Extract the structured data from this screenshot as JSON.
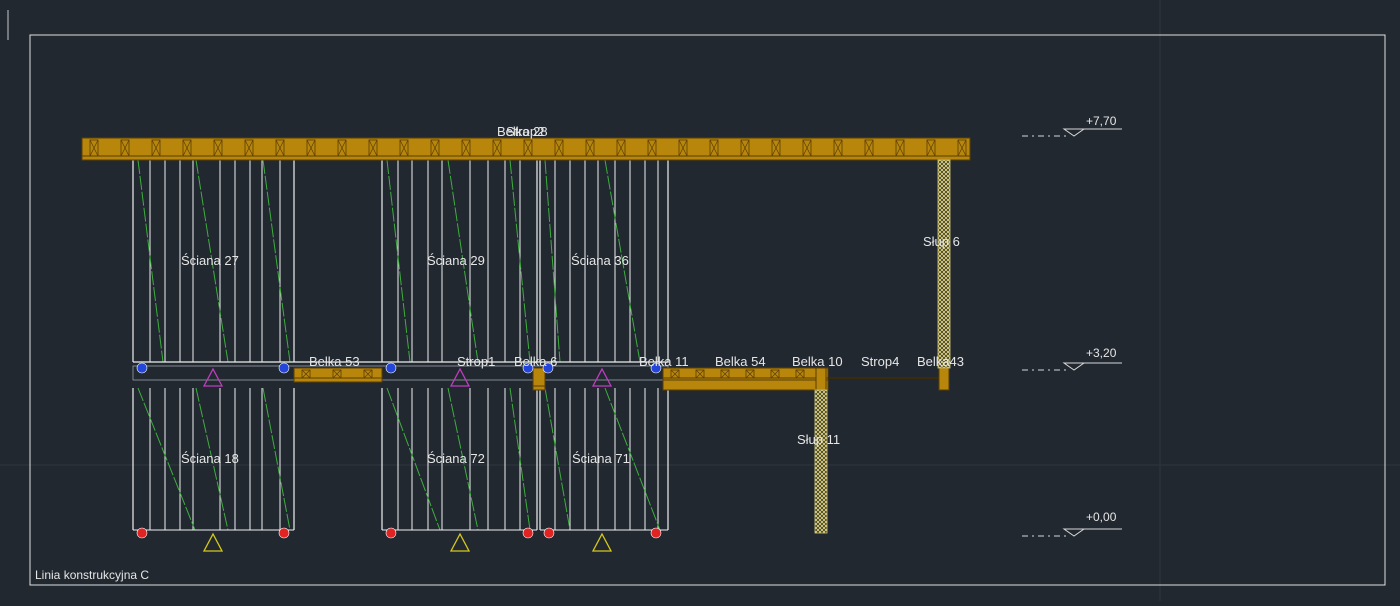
{
  "frame": {
    "caption": "Linia konstrukcyjna C"
  },
  "levels": [
    {
      "label": "+7,70"
    },
    {
      "label": "+3,20"
    },
    {
      "label": "+0,00"
    }
  ],
  "elements": {
    "top_slab": "Strop2",
    "top_beam_overlap": "Belka 28",
    "wall_27": "Ściana 27",
    "wall_29": "Ściana 29",
    "wall_36": "Ściana 36",
    "wall_18": "Ściana 18",
    "wall_72": "Ściana 72",
    "wall_71": "Ściana 71",
    "beam_53": "Belka 53",
    "slab_1": "Strop1",
    "beam_6": "Belka 6",
    "beam_11": "Belka 11",
    "beam_54": "Belka 54",
    "beam_10": "Belka 10",
    "slab_4": "Strop4",
    "beam_43": "Belka43",
    "column_6": "Słup 6",
    "column_11": "Słup 11"
  },
  "colors": {
    "background": "#212830",
    "frame_line": "#e8e8e8",
    "timber_fill": "#b8860b",
    "timber_edge": "#5a3e06",
    "wall_line": "#f0f0f0",
    "brace_line": "#3fae3f",
    "column_fill": "#d8cc7a",
    "support_red": "#e02424",
    "support_blue": "#2346d8",
    "marker_magenta": "#c03cc0",
    "marker_yellow": "#d8c81a"
  }
}
